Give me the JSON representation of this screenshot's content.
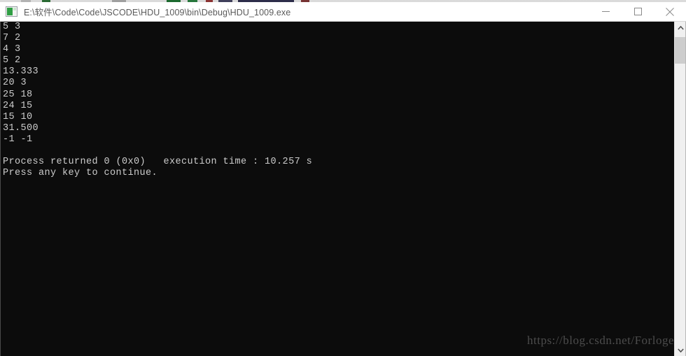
{
  "window": {
    "title": "E:\\软件\\Code\\Code\\JSCODE\\HDU_1009\\bin\\Debug\\HDU_1009.exe",
    "icon": "console-app-icon",
    "controls": {
      "minimize_label": "Minimize",
      "maximize_label": "Maximize",
      "close_label": "Close"
    }
  },
  "console": {
    "background_color": "#0c0c0c",
    "text_color": "#cccccc",
    "output": "5 3\n7 2\n4 3\n5 2\n13.333\n20 3\n25 18\n24 15\n15 10\n31.500\n-1 -1\n\nProcess returned 0 (0x0)   execution time : 10.257 s\nPress any key to continue.",
    "lines": [
      "5 3",
      "7 2",
      "4 3",
      "5 2",
      "13.333",
      "20 3",
      "25 18",
      "24 15",
      "15 10",
      "31.500",
      "-1 -1",
      "",
      "Process returned 0 (0x0)   execution time : 10.257 s",
      "Press any key to continue."
    ],
    "exit_code": "0 (0x0)",
    "execution_time": "10.257 s"
  },
  "watermark": {
    "text": "https://blog.csdn.net/Forlogen"
  },
  "scrollbar": {
    "up_arrow": "chevron-up-icon",
    "down_arrow": "chevron-down-icon",
    "thumb_color": "#cdcdcd"
  }
}
